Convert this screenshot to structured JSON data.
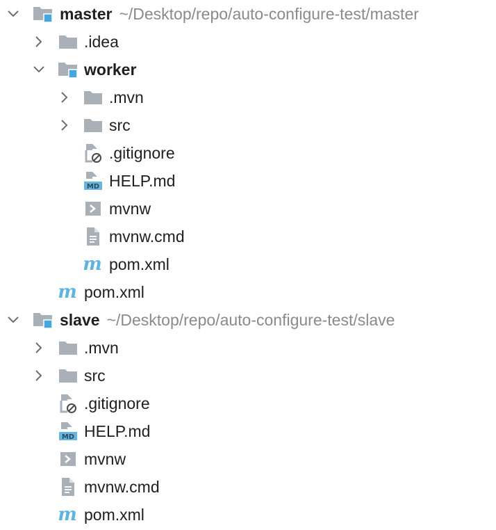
{
  "tree": [
    {
      "label": "master",
      "bold": true,
      "path": "~/Desktop/repo/auto-configure-test/master",
      "icon": "module-folder-icon",
      "chevron": "expanded",
      "name": "tree-node-master"
    },
    {
      "label": ".idea",
      "bold": false,
      "path": "",
      "icon": "folder-icon",
      "chevron": "collapsed",
      "name": "tree-node-idea"
    },
    {
      "label": "worker",
      "bold": true,
      "path": "",
      "icon": "module-folder-icon",
      "chevron": "expanded",
      "name": "tree-node-worker"
    },
    {
      "label": ".mvn",
      "bold": false,
      "path": "",
      "icon": "folder-icon",
      "chevron": "collapsed",
      "name": "tree-node-worker-mvn"
    },
    {
      "label": "src",
      "bold": false,
      "path": "",
      "icon": "folder-icon",
      "chevron": "collapsed",
      "name": "tree-node-worker-src"
    },
    {
      "label": ".gitignore",
      "bold": false,
      "path": "",
      "icon": "ignored-file-icon",
      "chevron": "none",
      "name": "tree-node-worker-gitignore"
    },
    {
      "label": "HELP.md",
      "bold": false,
      "path": "",
      "icon": "markdown-file-icon",
      "chevron": "none",
      "name": "tree-node-worker-help-md"
    },
    {
      "label": "mvnw",
      "bold": false,
      "path": "",
      "icon": "shell-script-icon",
      "chevron": "none",
      "name": "tree-node-worker-mvnw"
    },
    {
      "label": "mvnw.cmd",
      "bold": false,
      "path": "",
      "icon": "text-file-icon",
      "chevron": "none",
      "name": "tree-node-worker-mvnw-cmd"
    },
    {
      "label": "pom.xml",
      "bold": false,
      "path": "",
      "icon": "maven-pom-icon",
      "chevron": "none",
      "name": "tree-node-worker-pom"
    },
    {
      "label": "pom.xml",
      "bold": false,
      "path": "",
      "icon": "maven-pom-icon",
      "chevron": "none",
      "name": "tree-node-master-pom"
    },
    {
      "label": "slave",
      "bold": true,
      "path": "~/Desktop/repo/auto-configure-test/slave",
      "icon": "module-folder-icon",
      "chevron": "expanded",
      "name": "tree-node-slave"
    },
    {
      "label": ".mvn",
      "bold": false,
      "path": "",
      "icon": "folder-icon",
      "chevron": "collapsed",
      "name": "tree-node-slave-mvn"
    },
    {
      "label": "src",
      "bold": false,
      "path": "",
      "icon": "folder-icon",
      "chevron": "collapsed",
      "name": "tree-node-slave-src"
    },
    {
      "label": ".gitignore",
      "bold": false,
      "path": "",
      "icon": "ignored-file-icon",
      "chevron": "none",
      "name": "tree-node-slave-gitignore"
    },
    {
      "label": "HELP.md",
      "bold": false,
      "path": "",
      "icon": "markdown-file-icon",
      "chevron": "none",
      "name": "tree-node-slave-help-md"
    },
    {
      "label": "mvnw",
      "bold": false,
      "path": "",
      "icon": "shell-script-icon",
      "chevron": "none",
      "name": "tree-node-slave-mvnw"
    },
    {
      "label": "mvnw.cmd",
      "bold": false,
      "path": "",
      "icon": "text-file-icon",
      "chevron": "none",
      "name": "tree-node-slave-mvnw-cmd"
    },
    {
      "label": "pom.xml",
      "bold": false,
      "path": "",
      "icon": "maven-pom-icon",
      "chevron": "none",
      "name": "tree-node-slave-pom"
    }
  ],
  "icon_colors": {
    "folder": "#a9b0b8",
    "module_badge": "#45a7e0",
    "markdown_badge": "#66b6e0",
    "maven": "#5fb3e0",
    "file": "#a9b0b8"
  },
  "path_color": "#8a8a8a"
}
